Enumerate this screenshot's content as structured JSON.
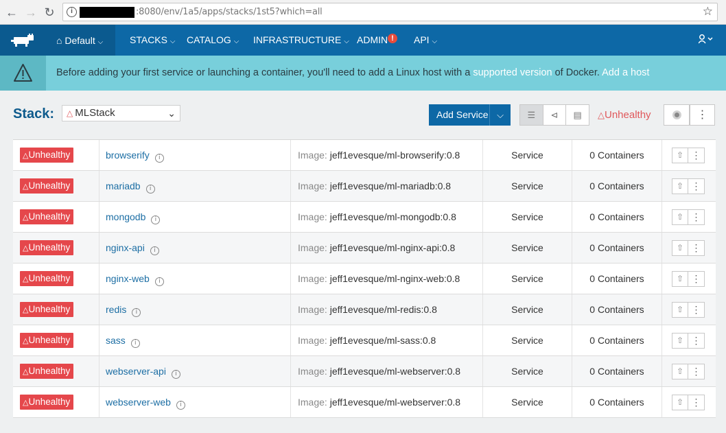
{
  "browser": {
    "url": ":8080/env/1a5/apps/stacks/1st5?which=all"
  },
  "nav": {
    "env": "Default",
    "items": [
      "STACKS",
      "CATALOG",
      "INFRASTRUCTURE",
      "ADMIN",
      "API"
    ],
    "admin_alert": "!"
  },
  "banner": {
    "text_before": "Before adding your first service or launching a container, you'll need to add a Linux host with a ",
    "link1": "supported version",
    "text_middle": " of Docker. ",
    "link2": "Add a host"
  },
  "stack": {
    "label": "Stack:",
    "selected": "MLStack",
    "add_service": "Add Service",
    "status": "Unhealthy"
  },
  "services": [
    {
      "status": "Unhealthy",
      "name": "browserify",
      "image_label": "Image:",
      "image": "jeff1evesque/ml-browserify:0.8",
      "kind": "Service",
      "containers": "0 Containers"
    },
    {
      "status": "Unhealthy",
      "name": "mariadb",
      "image_label": "Image:",
      "image": "jeff1evesque/ml-mariadb:0.8",
      "kind": "Service",
      "containers": "0 Containers"
    },
    {
      "status": "Unhealthy",
      "name": "mongodb",
      "image_label": "Image:",
      "image": "jeff1evesque/ml-mongodb:0.8",
      "kind": "Service",
      "containers": "0 Containers"
    },
    {
      "status": "Unhealthy",
      "name": "nginx-api",
      "image_label": "Image:",
      "image": "jeff1evesque/ml-nginx-api:0.8",
      "kind": "Service",
      "containers": "0 Containers"
    },
    {
      "status": "Unhealthy",
      "name": "nginx-web",
      "image_label": "Image:",
      "image": "jeff1evesque/ml-nginx-web:0.8",
      "kind": "Service",
      "containers": "0 Containers"
    },
    {
      "status": "Unhealthy",
      "name": "redis",
      "image_label": "Image:",
      "image": "jeff1evesque/ml-redis:0.8",
      "kind": "Service",
      "containers": "0 Containers"
    },
    {
      "status": "Unhealthy",
      "name": "sass",
      "image_label": "Image:",
      "image": "jeff1evesque/ml-sass:0.8",
      "kind": "Service",
      "containers": "0 Containers"
    },
    {
      "status": "Unhealthy",
      "name": "webserver-api",
      "image_label": "Image:",
      "image": "jeff1evesque/ml-webserver:0.8",
      "kind": "Service",
      "containers": "0 Containers"
    },
    {
      "status": "Unhealthy",
      "name": "webserver-web",
      "image_label": "Image:",
      "image": "jeff1evesque/ml-webserver:0.8",
      "kind": "Service",
      "containers": "0 Containers"
    }
  ],
  "colors": {
    "nav": "#0d68a6",
    "nav_dark": "#0b5a8f",
    "banner": "#78cfdb",
    "unhealthy": "#e5474b"
  }
}
